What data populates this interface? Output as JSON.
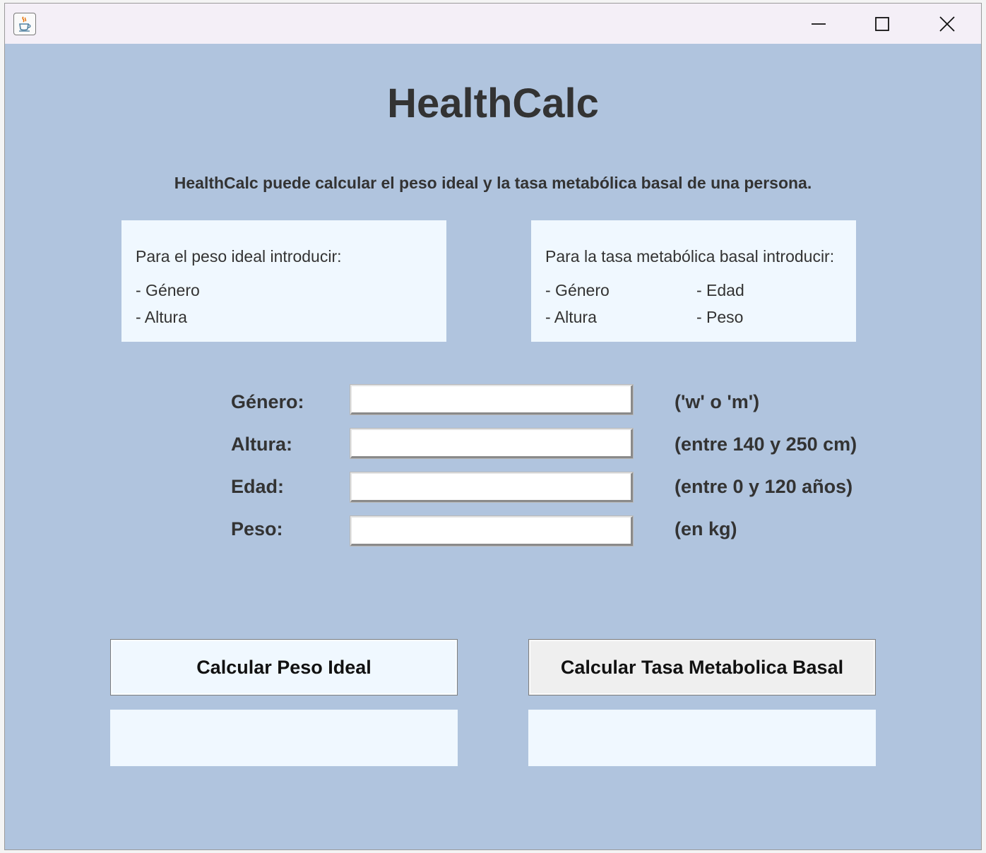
{
  "window": {
    "icon": "java-cup-icon",
    "controls": {
      "minimize": "minimize-icon",
      "maximize": "maximize-icon",
      "close": "close-icon"
    }
  },
  "app": {
    "title": "HealthCalc",
    "description": "HealthCalc puede calcular el peso ideal y la tasa metabólica basal de una persona."
  },
  "info_peso": {
    "heading": "Para el peso ideal introducir:",
    "items": [
      "- Género",
      "- Altura"
    ]
  },
  "info_tasa": {
    "heading": "Para la tasa metabólica basal introducir:",
    "items": [
      "- Género",
      "- Edad",
      "- Altura",
      "- Peso"
    ]
  },
  "form": {
    "genero": {
      "label": "Género:",
      "value": "",
      "hint": "('w' o 'm')"
    },
    "altura": {
      "label": "Altura:",
      "value": "",
      "hint": "(entre 140 y 250 cm)"
    },
    "edad": {
      "label": "Edad:",
      "value": "",
      "hint": "(entre 0 y 120 años)"
    },
    "peso": {
      "label": "Peso:",
      "value": "",
      "hint": "(en kg)"
    }
  },
  "buttons": {
    "peso_ideal": "Calcular Peso Ideal",
    "tasa_metabolica": "Calcular Tasa Metabolica Basal"
  },
  "results": {
    "peso_ideal": "",
    "tasa_metabolica": ""
  },
  "colors": {
    "background": "#b0c4de",
    "panel": "#f0f8ff",
    "text": "#333333",
    "titlebar": "#f4eff7"
  }
}
